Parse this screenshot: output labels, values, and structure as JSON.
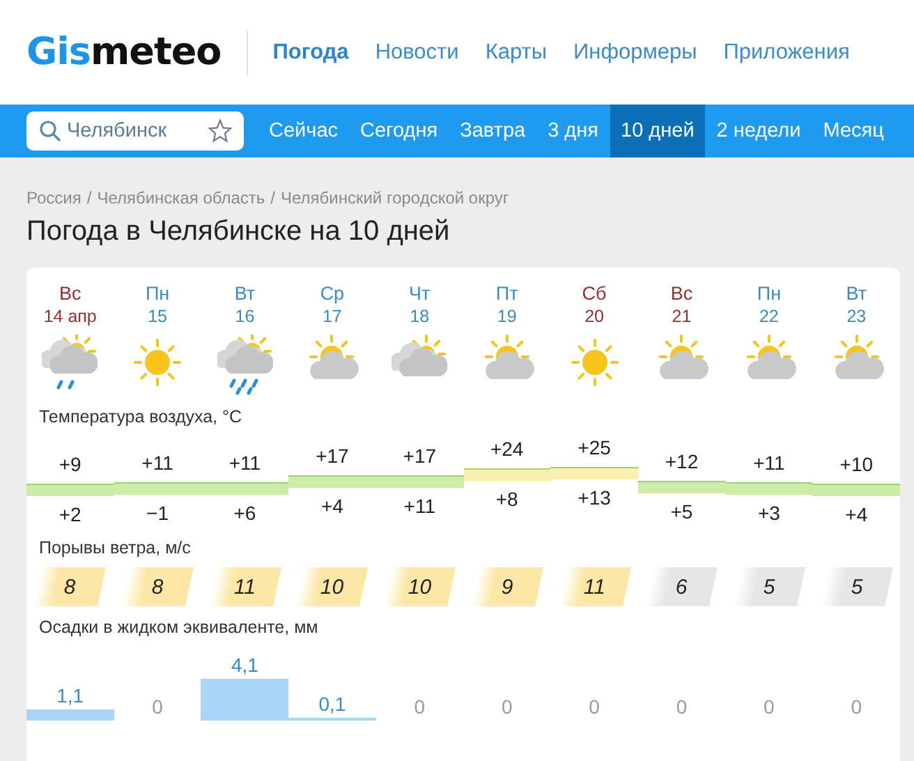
{
  "header": {
    "logo": {
      "accent": "Gis",
      "rest": "meteo"
    },
    "nav": [
      {
        "label": "Погода",
        "selected": true
      },
      {
        "label": "Новости",
        "selected": false
      },
      {
        "label": "Карты",
        "selected": false
      },
      {
        "label": "Информеры",
        "selected": false
      },
      {
        "label": "Приложения",
        "selected": false
      }
    ]
  },
  "toolbar": {
    "search": {
      "value": "Челябинск"
    },
    "tabs": [
      {
        "label": "Сейчас",
        "selected": false
      },
      {
        "label": "Сегодня",
        "selected": false
      },
      {
        "label": "Завтра",
        "selected": false
      },
      {
        "label": "3 дня",
        "selected": false
      },
      {
        "label": "10 дней",
        "selected": true
      },
      {
        "label": "2 недели",
        "selected": false
      },
      {
        "label": "Месяц",
        "selected": false
      }
    ]
  },
  "breadcrumbs": [
    "Россия",
    "/",
    "Челябинская область",
    "/",
    "Челябинский городской округ"
  ],
  "title": "Погода в Челябинске на 10 дней",
  "days": [
    {
      "weekday": "Вс",
      "date": "14 апр",
      "weekend": true,
      "kind": "cloud-rain",
      "max": "+9",
      "min": "+2"
    },
    {
      "weekday": "Пн",
      "date": "15",
      "weekend": false,
      "kind": "sun",
      "max": "+11",
      "min": "−1"
    },
    {
      "weekday": "Вт",
      "date": "16",
      "weekend": false,
      "kind": "cloud-heavy-rain",
      "max": "+11",
      "min": "+6"
    },
    {
      "weekday": "Ср",
      "date": "17",
      "weekend": false,
      "kind": "sun-cloud",
      "max": "+17",
      "min": "+4"
    },
    {
      "weekday": "Чт",
      "date": "18",
      "weekend": false,
      "kind": "cloud",
      "max": "+17",
      "min": "+11"
    },
    {
      "weekday": "Пт",
      "date": "19",
      "weekend": false,
      "kind": "sun-cloud",
      "max": "+24",
      "min": "+8"
    },
    {
      "weekday": "Сб",
      "date": "20",
      "weekend": true,
      "kind": "sun",
      "max": "+25",
      "min": "+13"
    },
    {
      "weekday": "Вс",
      "date": "21",
      "weekend": true,
      "kind": "sun-cloud",
      "max": "+12",
      "min": "+5"
    },
    {
      "weekday": "Пн",
      "date": "22",
      "weekend": false,
      "kind": "sun-cloud",
      "max": "+11",
      "min": "+3"
    },
    {
      "weekday": "Вт",
      "date": "23",
      "weekend": false,
      "kind": "sun-cloud",
      "max": "+10",
      "min": "+4"
    }
  ],
  "temperature": {
    "label": "Температура воздуха, °C",
    "bands": [
      {
        "color": "#cdeca8"
      },
      {
        "color": "#cdeca8"
      },
      {
        "color": "#cdeca8"
      },
      {
        "color": "#cdeca8"
      },
      {
        "color": "#cdeca8"
      },
      {
        "color": "#fbefb0"
      },
      {
        "color": "#fbefb0"
      },
      {
        "color": "#cdeca8"
      },
      {
        "color": "#cdeca8"
      },
      {
        "color": "#cdeca8"
      }
    ]
  },
  "wind": {
    "label": "Порывы ветра, м/с",
    "items": [
      {
        "value": "8",
        "color": "#fde7a6"
      },
      {
        "value": "8",
        "color": "#fde7a6"
      },
      {
        "value": "11",
        "color": "#fde7a6"
      },
      {
        "value": "10",
        "color": "#fde7a6"
      },
      {
        "value": "10",
        "color": "#fde7a6"
      },
      {
        "value": "9",
        "color": "#fde7a6"
      },
      {
        "value": "11",
        "color": "#fde7a6"
      },
      {
        "value": "6",
        "color": "#e6e6e6"
      },
      {
        "value": "5",
        "color": "#e6e6e6"
      },
      {
        "value": "5",
        "color": "#e6e6e6"
      }
    ]
  },
  "precipitation": {
    "label": "Осадки в жидком эквиваленте, мм",
    "items": [
      {
        "value": "1,1"
      },
      {
        "value": "0"
      },
      {
        "value": "4,1"
      },
      {
        "value": "0,1"
      },
      {
        "value": "0"
      },
      {
        "value": "0"
      },
      {
        "value": "0"
      },
      {
        "value": "0"
      },
      {
        "value": "0"
      },
      {
        "value": "0"
      }
    ]
  }
}
